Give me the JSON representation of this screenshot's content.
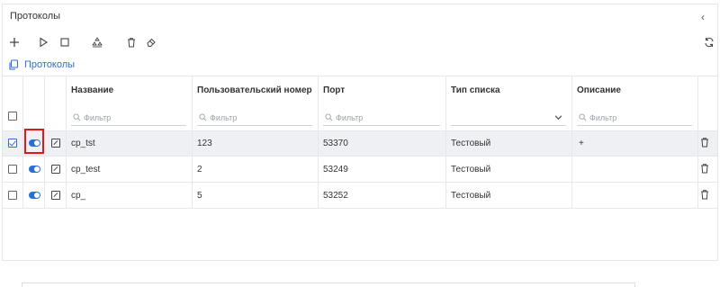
{
  "panel": {
    "title": "Протоколы",
    "collapse_icon": "chevron-left-icon"
  },
  "toolbar": {
    "add": "plus-icon",
    "play": "play-icon",
    "stop": "stop-icon",
    "cluster": "cluster-icon",
    "delete": "trash-icon",
    "clear": "eraser-icon",
    "refresh": "refresh-icon"
  },
  "breadcrumb": {
    "label": "Протоколы",
    "icon": "copy-icon"
  },
  "table": {
    "columns": [
      "Название",
      "Пользовательский номер",
      "Порт",
      "Тип списка",
      "Описание"
    ],
    "filter_placeholder": "Фильтр",
    "rows": [
      {
        "name": "cp_tst",
        "number": "123",
        "port": "53370",
        "list_type": "Тестовый",
        "description": "+",
        "checked": true,
        "enabled": true
      },
      {
        "name": "cp_test",
        "number": "2",
        "port": "53249",
        "list_type": "Тестовый",
        "description": "",
        "checked": false,
        "enabled": true
      },
      {
        "name": "cp_",
        "number": "5",
        "port": "53252",
        "list_type": "Тестовый",
        "description": "",
        "checked": false,
        "enabled": true
      }
    ]
  },
  "colors": {
    "accent": "#2b6fd6",
    "highlight": "#e01818",
    "selected_row": "#eef0f3"
  }
}
